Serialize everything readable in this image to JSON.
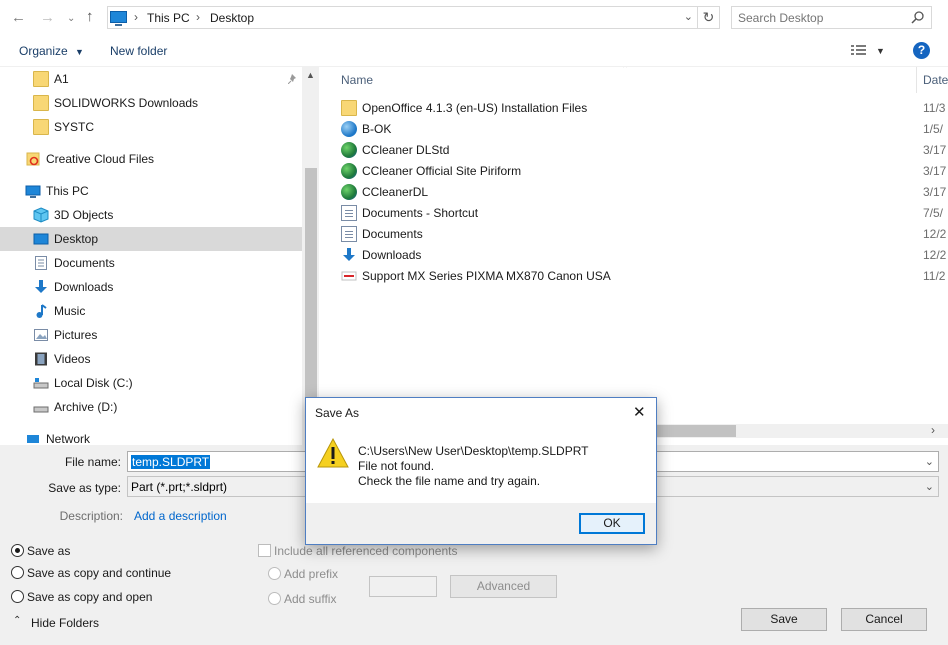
{
  "address_bar": {
    "breadcrumbs": [
      "This PC",
      "Desktop"
    ],
    "search_placeholder": "Search Desktop"
  },
  "toolbar": {
    "organize_label": "Organize",
    "new_folder_label": "New folder"
  },
  "nav_pane": {
    "items": [
      {
        "label": "A1",
        "icon": "folder-icon"
      },
      {
        "label": "SOLIDWORKS Downloads",
        "icon": "folder-icon"
      },
      {
        "label": "SYSTC",
        "icon": "folder-icon"
      },
      {
        "label": "Creative Cloud Files",
        "icon": "creative-cloud-icon"
      },
      {
        "label": "This PC",
        "icon": "pc-icon"
      },
      {
        "label": "3D Objects",
        "icon": "3d-objects-icon"
      },
      {
        "label": "Desktop",
        "icon": "desktop-icon",
        "selected": true
      },
      {
        "label": "Documents",
        "icon": "documents-icon"
      },
      {
        "label": "Downloads",
        "icon": "downloads-icon"
      },
      {
        "label": "Music",
        "icon": "music-icon"
      },
      {
        "label": "Pictures",
        "icon": "pictures-icon"
      },
      {
        "label": "Videos",
        "icon": "videos-icon"
      },
      {
        "label": "Local Disk (C:)",
        "icon": "drive-icon"
      },
      {
        "label": "Archive (D:)",
        "icon": "drive-icon"
      },
      {
        "label": "Network",
        "icon": "network-icon"
      }
    ]
  },
  "file_list": {
    "columns": {
      "name": "Name",
      "date": "Date"
    },
    "rows": [
      {
        "name": "OpenOffice 4.1.3 (en-US) Installation Files",
        "date": "11/3",
        "icon": "folder-icon"
      },
      {
        "name": "B-OK",
        "date": "1/5/",
        "icon": "shortcut-icon"
      },
      {
        "name": "CCleaner DLStd",
        "date": "3/17",
        "icon": "internet-shortcut-icon"
      },
      {
        "name": "CCleaner Official Site  Piriform",
        "date": "3/17",
        "icon": "internet-shortcut-icon"
      },
      {
        "name": "CCleanerDL",
        "date": "3/17",
        "icon": "internet-shortcut-icon"
      },
      {
        "name": "Documents - Shortcut",
        "date": "7/5/",
        "icon": "document-shortcut-icon"
      },
      {
        "name": "Documents",
        "date": "12/2",
        "icon": "document-shortcut-icon"
      },
      {
        "name": "Downloads",
        "date": "12/2",
        "icon": "downloads-icon"
      },
      {
        "name": "Support  MX Series  PIXMA MX870  Canon USA",
        "date": "11/2",
        "icon": "canon-shortcut-icon"
      }
    ]
  },
  "form": {
    "file_name_label": "File name:",
    "file_name_value": "temp.SLDPRT",
    "save_as_type_label": "Save as type:",
    "save_as_type_value": "Part (*.prt;*.sldprt)",
    "description_label": "Description:",
    "description_link": "Add a description"
  },
  "options": {
    "save_as": "Save as",
    "save_as_copy_continue": "Save as copy and continue",
    "save_as_copy_open": "Save as copy and open",
    "include_references": "Include all referenced components",
    "add_prefix": "Add prefix",
    "add_suffix": "Add suffix",
    "advanced": "Advanced"
  },
  "footer": {
    "hide_folders": "Hide Folders",
    "save": "Save",
    "cancel": "Cancel"
  },
  "modal": {
    "title": "Save As",
    "path": "C:\\Users\\New User\\Desktop\\temp.SLDPRT",
    "line2": "File not found.",
    "line3": "Check the file name and try again.",
    "ok": "OK"
  },
  "colors": {
    "selection": "#0078d7",
    "nav_selected": "#d9d9d9",
    "link": "#0066cc",
    "help": "#1565c0",
    "warning": "#f5d020"
  }
}
